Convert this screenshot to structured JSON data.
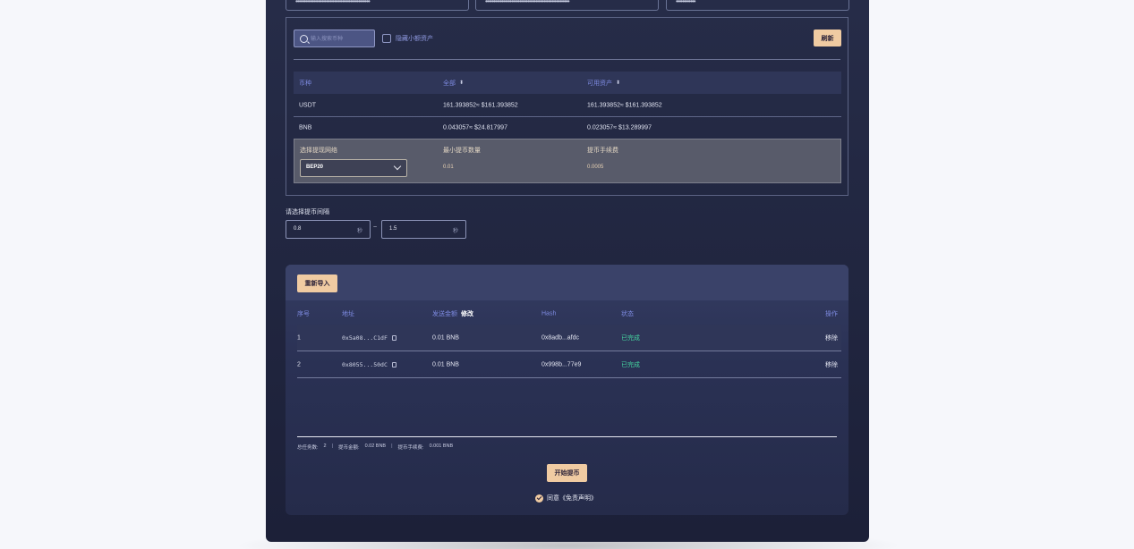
{
  "top_inputs": [
    {
      "value": "••••••••••••••••••••••••••••••••••••••••••••••"
    },
    {
      "value": "••••••••••••••••••••••••••••••••••••••••••••••••••••"
    },
    {
      "value": "••••••••••••"
    }
  ],
  "assets": {
    "search_placeholder": "输入搜索币种",
    "hide_small_label": "隐藏小额资产",
    "refresh_label": "刷新",
    "headers": {
      "coin": "币种",
      "total": "全部",
      "available": "可用资产",
      "sort_icon": "⬍"
    },
    "rows": [
      {
        "coin": "USDT",
        "total": "161.393852≈ $161.393852",
        "available": "161.393852≈ $161.393852"
      },
      {
        "coin": "BNB",
        "total": "0.043057≈ $24.817997",
        "available": "0.023057≈ $13.289997"
      }
    ],
    "expanded": {
      "network_label": "选择提现网络",
      "network_value": "BEP20",
      "min_label": "最小提币数量",
      "min_value": "0.01",
      "fee_label": "提币手续费",
      "fee_value": "0.0005"
    }
  },
  "interval": {
    "label": "请选择提币间隔",
    "min": "0.8",
    "max": "1.5",
    "unit": "秒",
    "separator": "~"
  },
  "tasks": {
    "reimport_label": "重新导入",
    "headers": {
      "index": "序号",
      "address": "地址",
      "amount": "发送金额",
      "modify": "修改",
      "hash": "Hash",
      "status": "状态",
      "action": "操作"
    },
    "rows": [
      {
        "index": "1",
        "address": "0x5a08...C1dF",
        "amount": "0.01 BNB",
        "hash": "0x8adb...afdc",
        "status": "已完成",
        "action": "移除"
      },
      {
        "index": "2",
        "address": "0x8055...50dC",
        "amount": "0.01 BNB",
        "hash": "0x998b...77e9",
        "status": "已完成",
        "action": "移除"
      }
    ],
    "summary": {
      "total_label": "总任务数:",
      "total_value": "2",
      "amount_label": "提币金额:",
      "amount_value": "0.02 BNB",
      "fee_label": "提币手续费:",
      "fee_value": "0.001 BNB",
      "separator": "|"
    },
    "start_label": "开始提币",
    "agree_text": "同意《免责声明》"
  },
  "colors": {
    "accent_gold": "#f0cba2",
    "header_blue": "#7d8ae0",
    "status_done": "#44d4a0",
    "panel_bg": "#262c48"
  }
}
